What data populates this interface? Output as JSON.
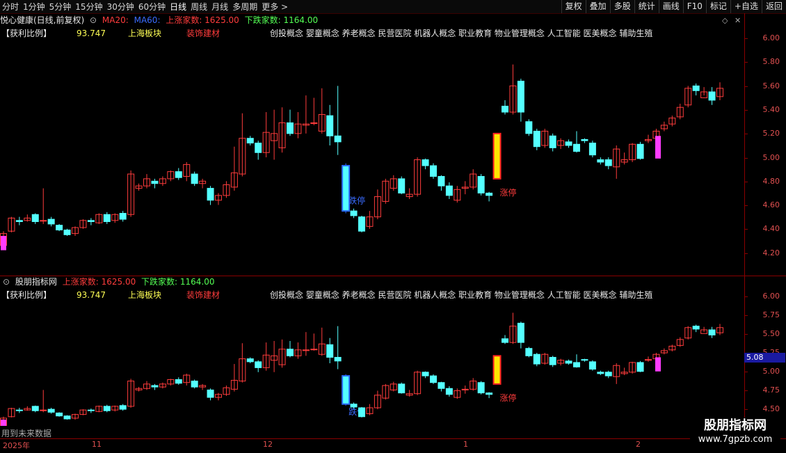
{
  "toolbar": {
    "left": [
      "分时",
      "1分钟",
      "5分钟",
      "15分钟",
      "30分钟",
      "60分钟",
      "日线",
      "周线",
      "月线",
      "多周期",
      "更多 >"
    ],
    "active": "日线",
    "right": [
      "复权",
      "叠加",
      "多股",
      "统计",
      "画线",
      "F10",
      "标记",
      "+自选",
      "返回"
    ]
  },
  "main": {
    "title": "悦心健康(日线,前复权)",
    "ma20": "MA20:",
    "ma60": "MA60:",
    "up_count": "上涨家数: 1625.00",
    "down_count": "下跌家数: 1164.00",
    "ratio_label": "【获利比例】",
    "ratio_value": "93.747",
    "board": "上海板块",
    "industry": "装饰建材",
    "concepts": "创投概念 婴童概念 养老概念 民营医院 机器人概念 职业教育 物业管理概念 人工智能 医美概念 辅助生殖",
    "axis": [
      "6.00",
      "5.80",
      "5.60",
      "5.40",
      "5.20",
      "5.00",
      "4.80",
      "4.60",
      "4.40",
      "4.20"
    ],
    "dn_label": "跌停",
    "up_label": "涨停"
  },
  "sub": {
    "title": "股朋指标网",
    "up_count": "上涨家数: 1625.00",
    "down_count": "下跌家数: 1164.00",
    "ratio_label": "【获利比例】",
    "ratio_value": "93.747",
    "board": "上海板块",
    "industry": "装饰建材",
    "concepts": "创投概念 婴童概念 养老概念 民营医院 机器人概念 职业教育 物业管理概念 人工智能 医美概念 辅助生殖",
    "axis": [
      "6.00",
      "5.75",
      "5.50",
      "5.25",
      "5.00",
      "4.75",
      "4.50"
    ],
    "price_tag": "5.08",
    "dn_label": "跌停",
    "up_label": "涨停"
  },
  "footer": {
    "future_note": "用到未来数据",
    "dates": [
      "2025年",
      "11",
      "12",
      "1",
      "2"
    ]
  },
  "watermark": {
    "name": "股朋指标网",
    "url": "www.7gpzb.com"
  },
  "colors": {
    "up": "#ff3c3c",
    "down": "#54ffff",
    "text_yellow": "#ffff55",
    "accent": "#ff2d2d"
  },
  "chart_data": {
    "type": "candlestick",
    "ylim": [
      4.1,
      6.1
    ],
    "candles": [
      [
        4.26,
        4.36,
        4.24,
        4.38
      ],
      [
        4.38,
        4.49,
        4.37,
        4.5
      ],
      [
        4.47,
        4.46,
        4.43,
        4.5
      ],
      [
        4.47,
        4.49,
        4.46,
        4.52
      ],
      [
        4.52,
        4.46,
        4.44,
        4.53
      ],
      [
        4.47,
        4.47,
        4.44,
        4.74
      ],
      [
        4.48,
        4.44,
        4.42,
        4.5
      ],
      [
        4.43,
        4.39,
        4.38,
        4.44
      ],
      [
        4.39,
        4.35,
        4.34,
        4.4
      ],
      [
        4.36,
        4.41,
        4.34,
        4.42
      ],
      [
        4.41,
        4.47,
        4.4,
        4.48
      ],
      [
        4.47,
        4.46,
        4.43,
        4.49
      ],
      [
        4.45,
        4.52,
        4.44,
        4.53
      ],
      [
        4.52,
        4.46,
        4.44,
        4.54
      ],
      [
        4.47,
        4.52,
        4.45,
        4.53
      ],
      [
        4.53,
        4.48,
        4.46,
        4.55
      ],
      [
        4.52,
        4.86,
        4.5,
        4.89
      ],
      [
        4.74,
        4.76,
        4.72,
        4.78
      ],
      [
        4.76,
        4.82,
        4.74,
        4.86
      ],
      [
        4.8,
        4.78,
        4.74,
        4.82
      ],
      [
        4.78,
        4.82,
        4.76,
        4.84
      ],
      [
        4.82,
        4.88,
        4.8,
        4.89
      ],
      [
        4.88,
        4.83,
        4.81,
        4.91
      ],
      [
        4.84,
        4.94,
        4.8,
        4.96
      ],
      [
        4.86,
        4.78,
        4.76,
        4.88
      ],
      [
        4.78,
        4.8,
        4.74,
        4.82
      ],
      [
        4.74,
        4.64,
        4.6,
        4.76
      ],
      [
        4.64,
        4.68,
        4.6,
        4.7
      ],
      [
        4.68,
        4.77,
        4.66,
        4.8
      ],
      [
        4.75,
        4.87,
        4.72,
        5.09
      ],
      [
        4.86,
        5.16,
        4.84,
        5.37
      ],
      [
        5.16,
        5.12,
        5.1,
        5.18
      ],
      [
        5.12,
        5.04,
        4.98,
        5.14
      ],
      [
        5.04,
        5.21,
        5.0,
        5.38
      ],
      [
        5.14,
        5.2,
        4.98,
        5.4
      ],
      [
        5.08,
        5.29,
        5.04,
        5.42
      ],
      [
        5.29,
        5.2,
        5.18,
        5.4
      ],
      [
        5.2,
        5.28,
        5.16,
        5.38
      ],
      [
        5.27,
        5.28,
        5.2,
        5.52
      ],
      [
        5.29,
        5.29,
        5.27,
        5.5
      ],
      [
        5.22,
        5.36,
        5.2,
        5.58
      ],
      [
        5.35,
        5.18,
        5.1,
        5.44
      ],
      [
        5.18,
        5.13,
        5.02,
        5.6
      ],
      [
        4.93,
        4.55,
        4.53,
        4.95
      ],
      [
        4.55,
        4.51,
        4.49,
        4.57
      ],
      [
        4.5,
        4.38,
        4.37,
        4.51
      ],
      [
        4.42,
        4.5,
        4.4,
        4.55
      ],
      [
        4.5,
        4.67,
        4.48,
        4.73
      ],
      [
        4.63,
        4.8,
        4.61,
        4.82
      ],
      [
        4.74,
        4.82,
        4.72,
        4.85
      ],
      [
        4.82,
        4.7,
        4.69,
        4.84
      ],
      [
        4.67,
        4.69,
        4.65,
        4.74
      ],
      [
        4.69,
        4.98,
        4.67,
        5.0
      ],
      [
        4.98,
        4.93,
        4.9,
        4.99
      ],
      [
        4.93,
        4.84,
        4.82,
        4.95
      ],
      [
        4.84,
        4.76,
        4.72,
        4.85
      ],
      [
        4.76,
        4.68,
        4.65,
        4.79
      ],
      [
        4.64,
        4.73,
        4.62,
        4.76
      ],
      [
        4.74,
        4.75,
        4.69,
        4.8
      ],
      [
        4.75,
        4.86,
        4.73,
        4.9
      ],
      [
        4.84,
        4.7,
        4.68,
        4.86
      ],
      [
        4.7,
        4.68,
        4.63,
        4.71
      ],
      [
        4.82,
        5.2,
        4.82,
        5.2
      ],
      [
        5.43,
        5.38,
        5.36,
        5.48
      ],
      [
        5.38,
        5.6,
        5.36,
        5.78
      ],
      [
        5.64,
        5.38,
        5.3,
        5.66
      ],
      [
        5.3,
        5.2,
        5.18,
        5.32
      ],
      [
        5.22,
        5.09,
        5.06,
        5.24
      ],
      [
        5.1,
        5.22,
        5.08,
        5.24
      ],
      [
        5.18,
        5.08,
        5.05,
        5.2
      ],
      [
        5.1,
        5.14,
        5.07,
        5.16
      ],
      [
        5.13,
        5.1,
        5.08,
        5.15
      ],
      [
        5.11,
        5.05,
        5.04,
        5.22
      ],
      [
        5.15,
        5.14,
        5.12,
        5.16
      ],
      [
        5.12,
        5.02,
        5.0,
        5.14
      ],
      [
        4.98,
        4.96,
        4.94,
        5.0
      ],
      [
        4.98,
        4.93,
        4.9,
        5.0
      ],
      [
        4.92,
        5.07,
        4.82,
        5.1
      ],
      [
        4.96,
        4.98,
        4.94,
        5.04
      ],
      [
        4.98,
        5.11,
        4.96,
        5.12
      ],
      [
        5.11,
        4.99,
        4.98,
        5.13
      ],
      [
        5.14,
        5.15,
        5.12,
        5.19
      ],
      [
        5.16,
        5.22,
        5.14,
        5.24
      ],
      [
        5.24,
        5.27,
        5.22,
        5.3
      ],
      [
        5.28,
        5.33,
        5.26,
        5.35
      ],
      [
        5.34,
        5.42,
        5.32,
        5.45
      ],
      [
        5.44,
        5.58,
        5.42,
        5.6
      ],
      [
        5.6,
        5.56,
        5.52,
        5.62
      ],
      [
        5.5,
        5.55,
        5.52,
        5.59
      ],
      [
        5.55,
        5.48,
        5.44,
        5.59
      ],
      [
        5.51,
        5.58,
        5.48,
        5.63
      ]
    ],
    "markers": {
      "limit_down_index": 43,
      "limit_up_index": 62
    }
  }
}
